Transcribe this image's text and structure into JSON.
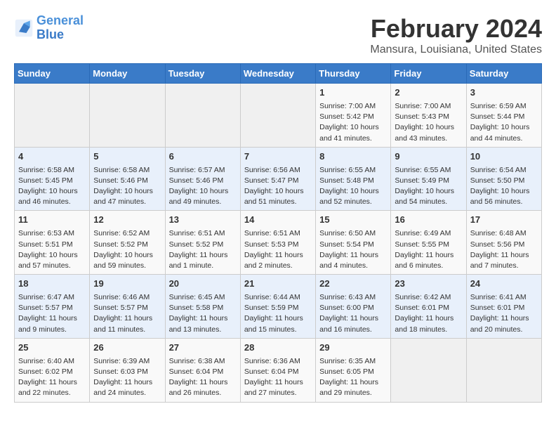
{
  "logo": {
    "line1": "General",
    "line2": "Blue"
  },
  "title": "February 2024",
  "location": "Mansura, Louisiana, United States",
  "days_of_week": [
    "Sunday",
    "Monday",
    "Tuesday",
    "Wednesday",
    "Thursday",
    "Friday",
    "Saturday"
  ],
  "weeks": [
    [
      {
        "day": "",
        "info": ""
      },
      {
        "day": "",
        "info": ""
      },
      {
        "day": "",
        "info": ""
      },
      {
        "day": "",
        "info": ""
      },
      {
        "day": "1",
        "info": "Sunrise: 7:00 AM\nSunset: 5:42 PM\nDaylight: 10 hours\nand 41 minutes."
      },
      {
        "day": "2",
        "info": "Sunrise: 7:00 AM\nSunset: 5:43 PM\nDaylight: 10 hours\nand 43 minutes."
      },
      {
        "day": "3",
        "info": "Sunrise: 6:59 AM\nSunset: 5:44 PM\nDaylight: 10 hours\nand 44 minutes."
      }
    ],
    [
      {
        "day": "4",
        "info": "Sunrise: 6:58 AM\nSunset: 5:45 PM\nDaylight: 10 hours\nand 46 minutes."
      },
      {
        "day": "5",
        "info": "Sunrise: 6:58 AM\nSunset: 5:46 PM\nDaylight: 10 hours\nand 47 minutes."
      },
      {
        "day": "6",
        "info": "Sunrise: 6:57 AM\nSunset: 5:46 PM\nDaylight: 10 hours\nand 49 minutes."
      },
      {
        "day": "7",
        "info": "Sunrise: 6:56 AM\nSunset: 5:47 PM\nDaylight: 10 hours\nand 51 minutes."
      },
      {
        "day": "8",
        "info": "Sunrise: 6:55 AM\nSunset: 5:48 PM\nDaylight: 10 hours\nand 52 minutes."
      },
      {
        "day": "9",
        "info": "Sunrise: 6:55 AM\nSunset: 5:49 PM\nDaylight: 10 hours\nand 54 minutes."
      },
      {
        "day": "10",
        "info": "Sunrise: 6:54 AM\nSunset: 5:50 PM\nDaylight: 10 hours\nand 56 minutes."
      }
    ],
    [
      {
        "day": "11",
        "info": "Sunrise: 6:53 AM\nSunset: 5:51 PM\nDaylight: 10 hours\nand 57 minutes."
      },
      {
        "day": "12",
        "info": "Sunrise: 6:52 AM\nSunset: 5:52 PM\nDaylight: 10 hours\nand 59 minutes."
      },
      {
        "day": "13",
        "info": "Sunrise: 6:51 AM\nSunset: 5:52 PM\nDaylight: 11 hours\nand 1 minute."
      },
      {
        "day": "14",
        "info": "Sunrise: 6:51 AM\nSunset: 5:53 PM\nDaylight: 11 hours\nand 2 minutes."
      },
      {
        "day": "15",
        "info": "Sunrise: 6:50 AM\nSunset: 5:54 PM\nDaylight: 11 hours\nand 4 minutes."
      },
      {
        "day": "16",
        "info": "Sunrise: 6:49 AM\nSunset: 5:55 PM\nDaylight: 11 hours\nand 6 minutes."
      },
      {
        "day": "17",
        "info": "Sunrise: 6:48 AM\nSunset: 5:56 PM\nDaylight: 11 hours\nand 7 minutes."
      }
    ],
    [
      {
        "day": "18",
        "info": "Sunrise: 6:47 AM\nSunset: 5:57 PM\nDaylight: 11 hours\nand 9 minutes."
      },
      {
        "day": "19",
        "info": "Sunrise: 6:46 AM\nSunset: 5:57 PM\nDaylight: 11 hours\nand 11 minutes."
      },
      {
        "day": "20",
        "info": "Sunrise: 6:45 AM\nSunset: 5:58 PM\nDaylight: 11 hours\nand 13 minutes."
      },
      {
        "day": "21",
        "info": "Sunrise: 6:44 AM\nSunset: 5:59 PM\nDaylight: 11 hours\nand 15 minutes."
      },
      {
        "day": "22",
        "info": "Sunrise: 6:43 AM\nSunset: 6:00 PM\nDaylight: 11 hours\nand 16 minutes."
      },
      {
        "day": "23",
        "info": "Sunrise: 6:42 AM\nSunset: 6:01 PM\nDaylight: 11 hours\nand 18 minutes."
      },
      {
        "day": "24",
        "info": "Sunrise: 6:41 AM\nSunset: 6:01 PM\nDaylight: 11 hours\nand 20 minutes."
      }
    ],
    [
      {
        "day": "25",
        "info": "Sunrise: 6:40 AM\nSunset: 6:02 PM\nDaylight: 11 hours\nand 22 minutes."
      },
      {
        "day": "26",
        "info": "Sunrise: 6:39 AM\nSunset: 6:03 PM\nDaylight: 11 hours\nand 24 minutes."
      },
      {
        "day": "27",
        "info": "Sunrise: 6:38 AM\nSunset: 6:04 PM\nDaylight: 11 hours\nand 26 minutes."
      },
      {
        "day": "28",
        "info": "Sunrise: 6:36 AM\nSunset: 6:04 PM\nDaylight: 11 hours\nand 27 minutes."
      },
      {
        "day": "29",
        "info": "Sunrise: 6:35 AM\nSunset: 6:05 PM\nDaylight: 11 hours\nand 29 minutes."
      },
      {
        "day": "",
        "info": ""
      },
      {
        "day": "",
        "info": ""
      }
    ]
  ]
}
